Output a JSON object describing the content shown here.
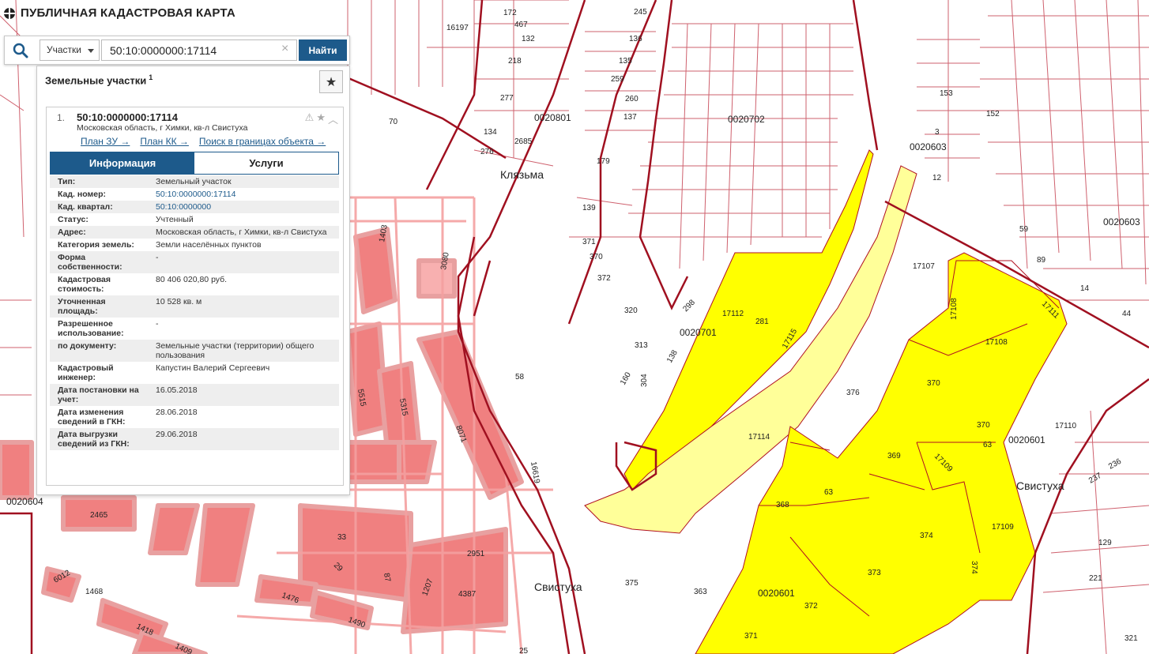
{
  "app": {
    "title": "ПУБЛИЧНАЯ КАДАСТРОВАЯ КАРТА"
  },
  "search": {
    "type_selected": "Участки",
    "query": "50:10:0000000:17114",
    "button_label": "Найти"
  },
  "panel": {
    "title": "Земельные участки",
    "count": "1",
    "result": {
      "index": "1.",
      "cad_number": "50:10:0000000:17114",
      "address": "Московская область, г Химки, кв-л Свистуха",
      "links": [
        "План ЗУ →",
        "План КК →",
        "Поиск в границах объекта →"
      ],
      "tabs": [
        "Информация",
        "Услуги"
      ],
      "info": [
        {
          "label": "Тип:",
          "value": "Земельный участок"
        },
        {
          "label": "Кад. номер:",
          "value": "50:10:0000000:17114"
        },
        {
          "label": "Кад. квартал:",
          "value": "50:10:0000000"
        },
        {
          "label": "Статус:",
          "value": "Учтенный"
        },
        {
          "label": "Адрес:",
          "value": "Московская область, г Химки, кв-л Свистуха"
        },
        {
          "label": "Категория земель:",
          "value": "Земли населённых пунктов"
        },
        {
          "label": "Форма собственности:",
          "value": "-"
        },
        {
          "label": "Кадастровая стоимость:",
          "value": "80 406 020,80 руб."
        },
        {
          "label": "Уточненная площадь:",
          "value": "10 528 кв. м"
        },
        {
          "label": "Разрешенное использование:",
          "value": "-"
        },
        {
          "label": "по документу:",
          "value": "Земельные участки (территории) общего пользования"
        },
        {
          "label": "Кадастровый инженер:",
          "value": "Капустин Валерий Сергеевич"
        },
        {
          "label": "Дата постановки на учет:",
          "value": "16.05.2018"
        },
        {
          "label": "Дата изменения сведений в ГКН:",
          "value": "28.06.2018"
        },
        {
          "label": "Дата выгрузки сведений из ГКН:",
          "value": "29.06.2018"
        }
      ]
    }
  },
  "map": {
    "place_names": [
      "Клязьма",
      "Свистуха",
      "Свистуха"
    ],
    "quarters": [
      "0020801",
      "0020702",
      "0020603",
      "0020603",
      "0020701",
      "0020601",
      "0020601",
      "0020604"
    ],
    "parcel_labels": [
      "17114",
      "17115",
      "17112",
      "281",
      "17107",
      "17108",
      "17108",
      "17111",
      "370",
      "370",
      "376",
      "369",
      "63",
      "63",
      "368",
      "17109",
      "17109",
      "374",
      "374",
      "373",
      "372",
      "371",
      "58",
      "16619",
      "375",
      "363",
      "17110",
      "70",
      "218",
      "277",
      "134",
      "2685",
      "276",
      "179",
      "139",
      "245",
      "136",
      "135",
      "259",
      "260",
      "137",
      "313",
      "304",
      "138",
      "160",
      "320",
      "371",
      "370",
      "372",
      "298",
      "25",
      "237",
      "236",
      "129",
      "221",
      "321",
      "59",
      "89",
      "14",
      "44",
      "152",
      "12",
      "153",
      "3",
      "16197",
      "172",
      "467",
      "132",
      "1207",
      "4387",
      "2951",
      "33",
      "29",
      "87",
      "1476",
      "1490",
      "1418",
      "1409",
      "1468",
      "6012",
      "2465",
      "8071",
      "5315",
      "5515",
      "3080",
      "1403"
    ],
    "colors": {
      "highlight": "#ffff00",
      "highlight_pale": "#ffff99",
      "border": "#b01020",
      "building": "#f08080",
      "building_outline": "#e8a0a0"
    }
  }
}
